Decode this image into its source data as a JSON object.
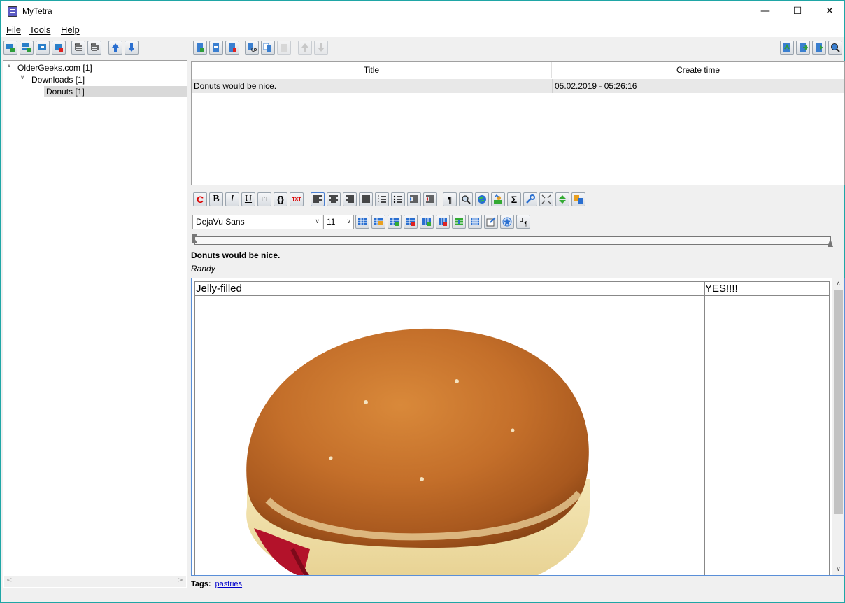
{
  "window": {
    "title": "MyTetra",
    "minimize": "—",
    "maximize": "☐",
    "close": "✕"
  },
  "menu": [
    {
      "label": "File"
    },
    {
      "label": "Tools"
    },
    {
      "label": "Help"
    }
  ],
  "tree": {
    "items": [
      {
        "label": "OlderGeeks.com [1]",
        "expanded": true
      },
      {
        "label": "Downloads [1]",
        "expanded": true
      },
      {
        "label": "Donuts [1]",
        "selected": true
      }
    ],
    "scroll_left": "<",
    "scroll_right": ">"
  },
  "records": {
    "columns": [
      "Title",
      "Create time"
    ],
    "rows": [
      {
        "title": "Donuts would be nice.",
        "create_time": "05.02.2019 - 05:26:16"
      }
    ]
  },
  "format_bar": {
    "bold": "B",
    "italic": "I",
    "underline": "U",
    "monospace": "TT",
    "code": "{}",
    "txt": "TXT",
    "pilcrow": "¶",
    "sigma": "Σ"
  },
  "font": {
    "family": "DejaVu Sans",
    "size": "11"
  },
  "note": {
    "title": "Donuts would be nice.",
    "author": "Randy",
    "table": {
      "cell_left": "Jelly-filled",
      "cell_right": "YES!!!!"
    }
  },
  "tags": {
    "label": "Tags:",
    "items": [
      "pastries"
    ]
  },
  "colors": {
    "accent_border": "#5a8fd8",
    "window_border": "#1fa6a6",
    "selection": "#d9d9d9",
    "link": "#0000cc"
  }
}
